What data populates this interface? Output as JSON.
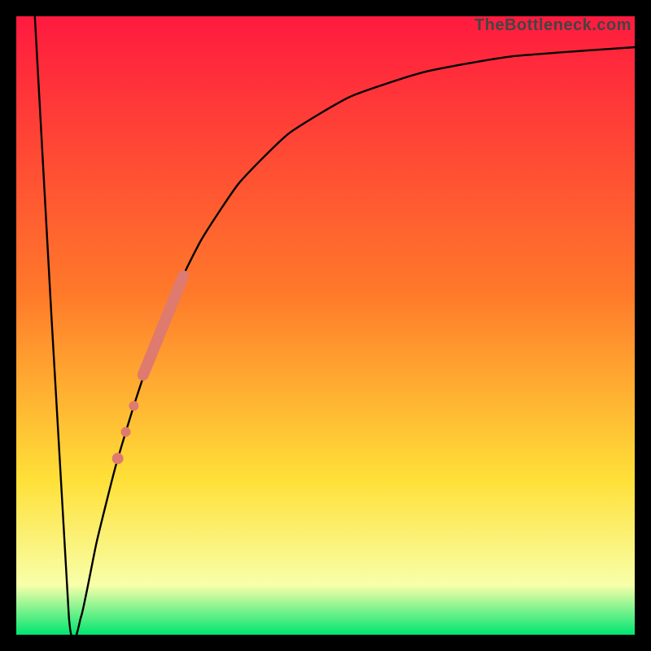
{
  "watermark": "TheBottleneck.com",
  "colors": {
    "top": "#ff1a3f",
    "mid1": "#ff7a2a",
    "mid2": "#ffe038",
    "pale": "#f8ffa9",
    "bottom": "#00e571",
    "curve_stroke": "#000000",
    "marker_fill": "#df7a6f",
    "frame": "#000000"
  },
  "chart_data": {
    "type": "line",
    "title": "",
    "xlabel": "",
    "ylabel": "",
    "xlim": [
      0,
      100
    ],
    "ylim": [
      0,
      100
    ],
    "curve": [
      {
        "x": 3.0,
        "y": 100
      },
      {
        "x": 8.5,
        "y": 3
      },
      {
        "x": 10.5,
        "y": 3
      },
      {
        "x": 13,
        "y": 15
      },
      {
        "x": 16,
        "y": 27
      },
      {
        "x": 19,
        "y": 37
      },
      {
        "x": 22,
        "y": 46
      },
      {
        "x": 26,
        "y": 56
      },
      {
        "x": 30,
        "y": 64
      },
      {
        "x": 36,
        "y": 73
      },
      {
        "x": 44,
        "y": 81
      },
      {
        "x": 54,
        "y": 87
      },
      {
        "x": 66,
        "y": 91
      },
      {
        "x": 80,
        "y": 93.5
      },
      {
        "x": 100,
        "y": 95
      }
    ],
    "marker_segment": {
      "x0": 20.5,
      "y0": 42,
      "x1": 27,
      "y1": 58,
      "width": 14
    },
    "marker_dots": [
      {
        "x": 19.0,
        "y": 37.0,
        "r": 6
      },
      {
        "x": 17.7,
        "y": 32.8,
        "r": 6
      },
      {
        "x": 16.4,
        "y": 28.5,
        "r": 7
      }
    ]
  }
}
